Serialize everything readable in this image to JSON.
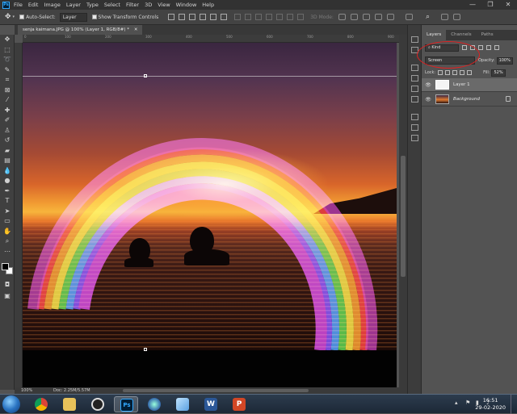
{
  "app": {
    "logo_text": "Ps"
  },
  "menu": [
    "File",
    "Edit",
    "Image",
    "Layer",
    "Type",
    "Select",
    "Filter",
    "3D",
    "View",
    "Window",
    "Help"
  ],
  "window_controls": {
    "minimize": "—",
    "restore": "❐",
    "close": "✕"
  },
  "options_bar": {
    "auto_select_label": "Auto-Select:",
    "auto_select_target": "Layer",
    "show_transform_label": "Show Transform Controls",
    "mode_3d_label": "3D Mode:"
  },
  "document": {
    "tab_title": "senja kaimana.JPG @ 100% (Layer 1, RGB/8#) *",
    "close_glyph": "✕"
  },
  "status": {
    "zoom": "100%",
    "doc_info": "Doc: 2.25M/5.57M"
  },
  "rulers": {
    "top": [
      "0",
      "100",
      "200",
      "300",
      "400",
      "500",
      "600",
      "700",
      "800",
      "900"
    ]
  },
  "layers_panel": {
    "tabs": [
      "Layers",
      "Channels",
      "Paths"
    ],
    "filter_kind": "Kind",
    "blend_mode": "Screen",
    "opacity_label": "Opacity:",
    "opacity_value": "100%",
    "lock_label": "Lock:",
    "fill_label": "Fill:",
    "fill_value": "52%",
    "layers": [
      {
        "name": "Layer 1",
        "visible": true,
        "selected": true
      },
      {
        "name": "Background",
        "visible": true,
        "selected": false,
        "locked": true
      }
    ]
  },
  "taskbar": {
    "clock_time": "16:51",
    "clock_date": "29-02-2020",
    "apps": [
      "chrome",
      "file-explorer",
      "inkscape",
      "photoshop",
      "media-app",
      "notes-app",
      "word",
      "powerpoint"
    ]
  },
  "colors": {
    "accent_ps": "#31a8ff",
    "annotation": "#e02020",
    "rainbow": [
      "#ff3c3c",
      "#ff9a2a",
      "#ffe640",
      "#4cd64c",
      "#3fa0ff",
      "#7a4cff",
      "#d040e0"
    ]
  }
}
